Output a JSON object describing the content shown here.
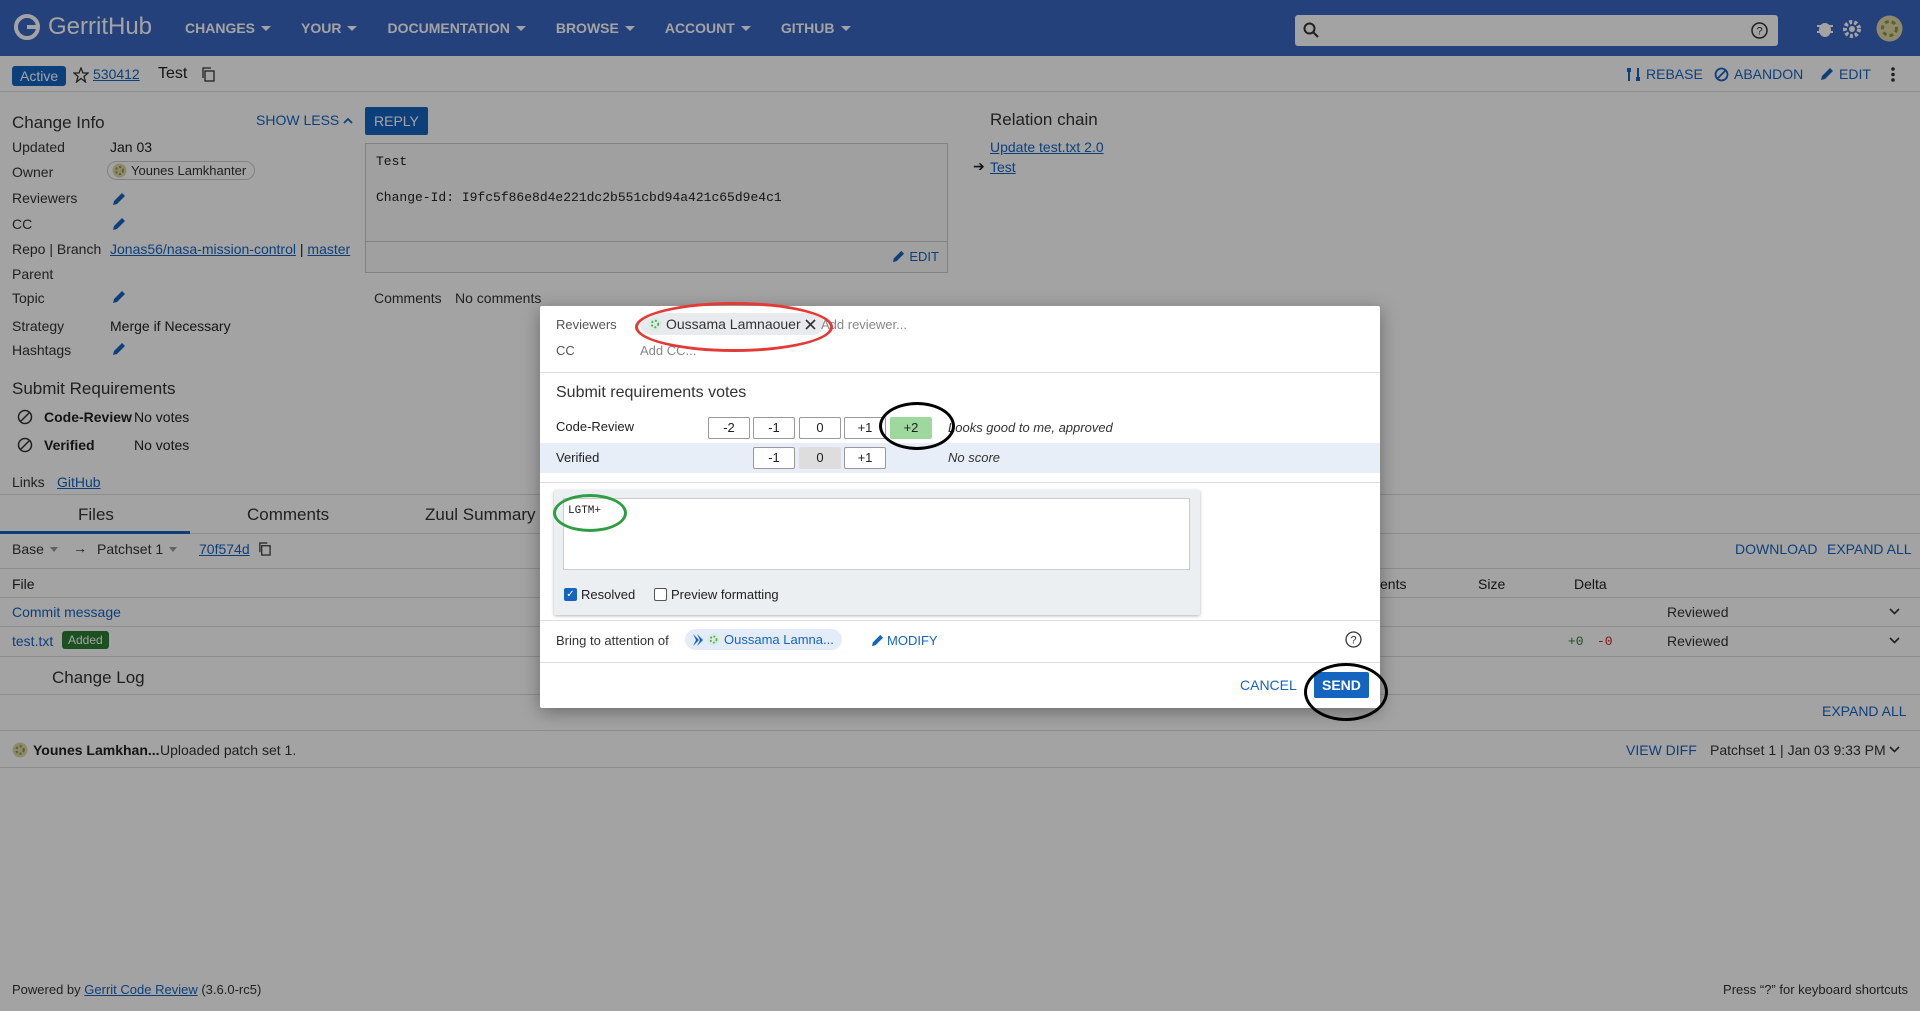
{
  "app": {
    "name": "GerritHub"
  },
  "nav": [
    "CHANGES",
    "YOUR",
    "DOCUMENTATION",
    "BROWSE",
    "ACCOUNT",
    "GITHUB"
  ],
  "subheader": {
    "status": "Active",
    "change_number": "530412",
    "subject": "Test",
    "actions": [
      "REBASE",
      "ABANDON",
      "EDIT"
    ]
  },
  "change_info": {
    "title": "Change Info",
    "show_less": "SHOW LESS",
    "updated_label": "Updated",
    "updated": "Jan 03",
    "owner_label": "Owner",
    "owner": "Younes Lamkhanter",
    "reviewers_label": "Reviewers",
    "cc_label": "CC",
    "repo_label": "Repo | Branch",
    "repo": "Jonas56/nasa-mission-control",
    "sep": "|",
    "branch": "master",
    "parent_label": "Parent",
    "topic_label": "Topic",
    "strategy_label": "Strategy",
    "strategy": "Merge if Necessary",
    "hashtags_label": "Hashtags"
  },
  "submit": {
    "title": "Submit Requirements",
    "items": [
      {
        "name": "Code-Review",
        "status": "No votes"
      },
      {
        "name": "Verified",
        "status": "No votes"
      }
    ]
  },
  "links": {
    "label": "Links",
    "github": "GitHub"
  },
  "reply_button": "REPLY",
  "commit": {
    "message": "Test\n\nChange-Id: I9fc5f86e8d4e221dc2b551cbd94a421c65d9e4c1",
    "edit": "EDIT"
  },
  "comments": {
    "label": "Comments",
    "value": "No comments"
  },
  "relation": {
    "title": "Relation chain",
    "items": [
      "Update test.txt 2.0",
      "Test"
    ]
  },
  "tabs": [
    "Files",
    "Comments",
    "Zuul Summary"
  ],
  "files": {
    "base": "Base",
    "arrow": "→",
    "patchset": "Patchset 1",
    "commit": "70f574d",
    "download": "DOWNLOAD",
    "expand": "EXPAND ALL",
    "col_file": "File",
    "col_comments": "ents",
    "col_size": "Size",
    "col_delta": "Delta",
    "rows": [
      {
        "name": "Commit message",
        "status": "Reviewed"
      },
      {
        "name": "test.txt",
        "badge": "Added",
        "plus": "+0",
        "minus": "-0",
        "status": "Reviewed"
      }
    ]
  },
  "changelog": {
    "title": "Change Log",
    "expand": "EXPAND ALL",
    "author": "Younes Lamkhan...",
    "msg": "Uploaded patch set 1.",
    "view_diff": "VIEW DIFF",
    "patch": "Patchset 1 | Jan 03 9:33 PM"
  },
  "footer": {
    "powered": "Powered by",
    "gerrit": "Gerrit Code Review",
    "version": "(3.6.0-rc5)",
    "shortcuts": "Press “?” for keyboard shortcuts"
  },
  "dialog": {
    "reviewers_label": "Reviewers",
    "reviewer": "Oussama Lamnaouer",
    "add_reviewer": "Add reviewer...",
    "cc_label": "CC",
    "add_cc": "Add CC...",
    "votes_title": "Submit requirements votes",
    "code_review_label": "Code-Review",
    "code_review_votes": [
      "-2",
      "-1",
      "0",
      "+1",
      "+2"
    ],
    "code_review_desc": "Looks good to me, approved",
    "verified_label": "Verified",
    "verified_votes": [
      "-1",
      "0",
      "+1"
    ],
    "verified_desc": "No score",
    "comment": "LGTM+",
    "resolved": "Resolved",
    "preview": "Preview formatting",
    "attention_label": "Bring to attention of",
    "attention_user": "Oussama Lamna...",
    "modify": "MODIFY",
    "cancel": "CANCEL",
    "send": "SEND"
  },
  "colors": {
    "header": "#3b66c0",
    "accent": "#1565c0",
    "approve": "#9fd89f",
    "ring_red": "#e53935",
    "ring_green": "#2e9e44",
    "ring_black": "#000000"
  }
}
